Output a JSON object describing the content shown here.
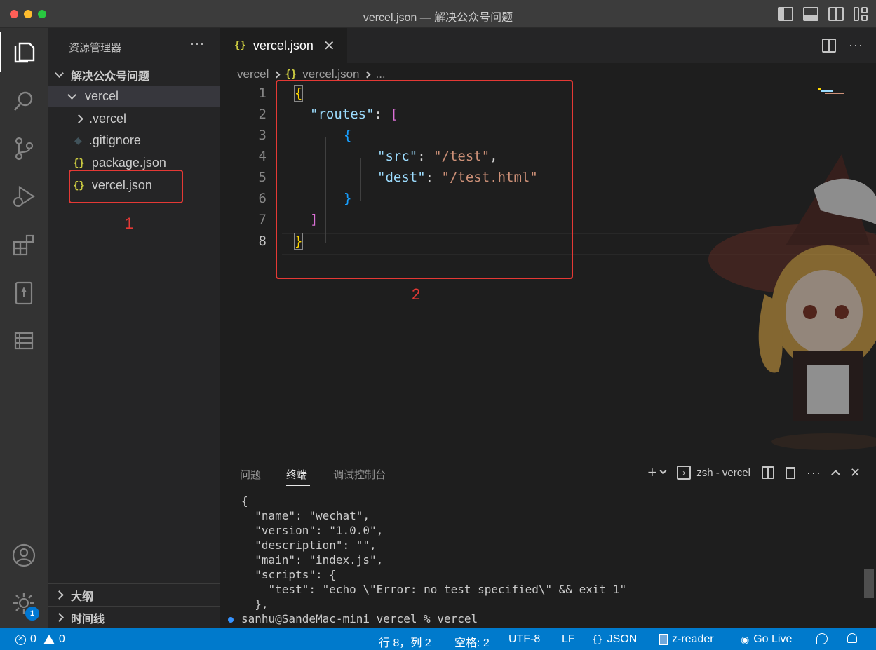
{
  "window": {
    "title": "vercel.json — 解决公众号问题"
  },
  "sidebar": {
    "header": "资源管理器",
    "more": "···",
    "root_folder": "解决公众号问题",
    "tree": [
      {
        "label": "vercel",
        "type": "folder-open"
      },
      {
        "label": ".vercel",
        "type": "folder-closed"
      },
      {
        "label": ".gitignore",
        "type": "file-git"
      },
      {
        "label": "package.json",
        "type": "file-json"
      },
      {
        "label": "vercel.json",
        "type": "file-json"
      }
    ],
    "sections": [
      "大纲",
      "时间线"
    ]
  },
  "annotations": {
    "box1_label": "1",
    "box2_label": "2",
    "color": "#e53935"
  },
  "editor": {
    "tab_label": "vercel.json",
    "json_icon": "{}",
    "breadcrumb": [
      "vercel",
      "vercel.json",
      "..."
    ],
    "lines": [
      {
        "n": "1",
        "text": "{"
      },
      {
        "n": "2",
        "text": "\"routes\": ["
      },
      {
        "n": "3",
        "text": "{"
      },
      {
        "n": "4",
        "text": "\"src\": \"/test\","
      },
      {
        "n": "5",
        "text": "\"dest\": \"/test.html\""
      },
      {
        "n": "6",
        "text": "}"
      },
      {
        "n": "7",
        "text": "]"
      },
      {
        "n": "8",
        "text": "}"
      }
    ],
    "tokens": {
      "routes_key": "\"routes\"",
      "src_key": "\"src\"",
      "src_val": "\"/test\"",
      "dest_key": "\"dest\"",
      "dest_val": "\"/test.html\""
    },
    "current_line": 8
  },
  "panel": {
    "tabs": [
      "问题",
      "终端",
      "调试控制台"
    ],
    "active_tab": "终端",
    "terminal_name": "zsh - vercel",
    "terminal_lines": [
      "{",
      "  \"name\": \"wechat\",",
      "  \"version\": \"1.0.0\",",
      "  \"description\": \"\",",
      "  \"main\": \"index.js\",",
      "  \"scripts\": {",
      "    \"test\": \"echo \\\"Error: no test specified\\\" && exit 1\"",
      "  },",
      "sanhu@SandeMac-mini vercel % vercel"
    ]
  },
  "activitybar": {
    "items": [
      "explorer-icon",
      "search-icon",
      "source-control-icon",
      "run-debug-icon",
      "extensions-icon",
      "reader-icon",
      "database-icon"
    ],
    "bottom": [
      "account-icon",
      "settings-gear-icon"
    ],
    "settings_badge": "1"
  },
  "statusbar": {
    "errors": "0",
    "warnings": "0",
    "position": "行 8，列 2",
    "indent": "空格: 2",
    "encoding": "UTF-8",
    "eol": "LF",
    "language": "JSON",
    "language_icon": "{}",
    "reader": "z-reader",
    "live": "Go Live",
    "bg_color": "#007acc"
  }
}
